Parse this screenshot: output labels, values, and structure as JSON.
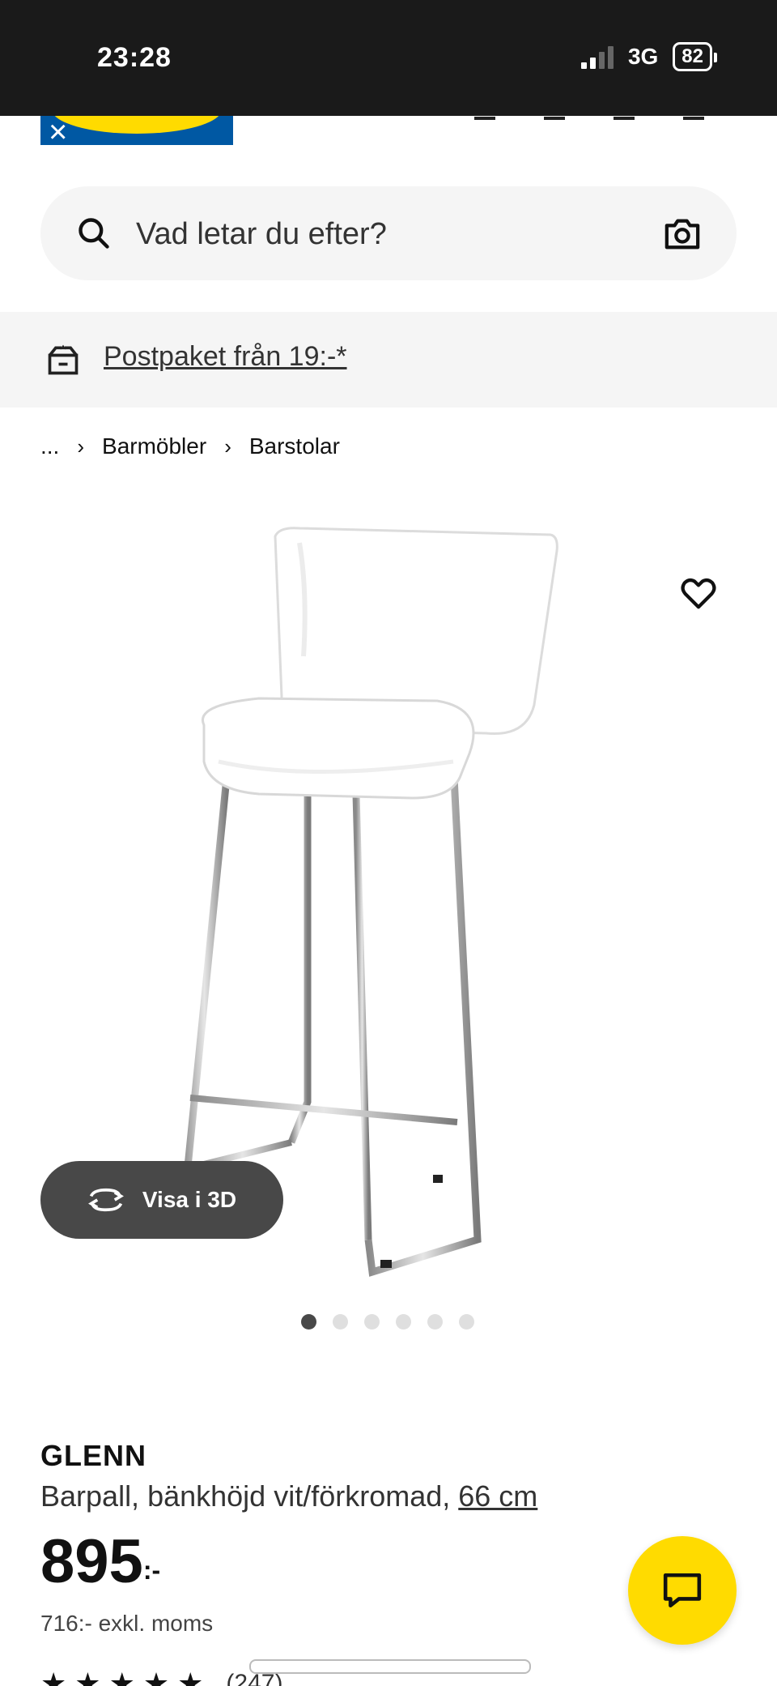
{
  "status_bar": {
    "time": "23:28",
    "network": "3G",
    "battery": "82"
  },
  "search": {
    "placeholder": "Vad letar du efter?"
  },
  "promo": {
    "text": "Postpaket från 19:-*"
  },
  "breadcrumb": {
    "items": [
      "...",
      "Barmöbler",
      "Barstolar"
    ]
  },
  "product": {
    "view_3d_label": "Visa i 3D",
    "image_count": 6,
    "active_image_index": 0,
    "brand": "GLENN",
    "description": "Barpall, bänkhöjd vit/förkromad,",
    "size_link": "66 cm",
    "price": "895",
    "price_suffix": ":-",
    "price_excl_vat": "716:- exkl. moms",
    "rating_stars": 5,
    "reviews_count": "(247)"
  },
  "colors": {
    "ikea_blue": "#0058a3",
    "ikea_yellow": "#ffdb00",
    "dark_button": "#484848"
  },
  "icons": {
    "search": "search-icon",
    "camera": "camera-icon",
    "parcel": "parcel-icon",
    "wishlist": "heart-icon",
    "rotate_3d": "rotate-3d-icon",
    "chat": "chat-icon"
  }
}
